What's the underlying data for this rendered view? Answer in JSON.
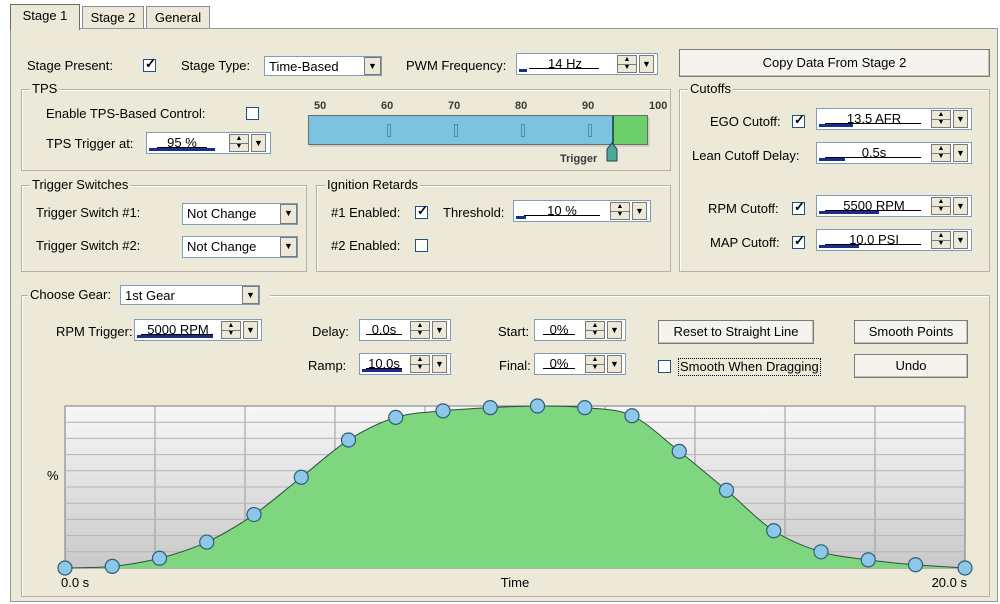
{
  "tabs": [
    "Stage 1",
    "Stage 2",
    "General"
  ],
  "top": {
    "stage_present_label": "Stage Present:",
    "stage_type_label": "Stage Type:",
    "stage_type_value": "Time-Based",
    "pwm_label": "PWM Frequency:",
    "pwm_value": "14 Hz",
    "copy_button": "Copy Data From Stage 2"
  },
  "tps": {
    "title": "TPS",
    "enable_label": "Enable TPS-Based Control:",
    "trigger_label": "TPS Trigger at:",
    "trigger_value": "95 %",
    "scale_ticks": [
      "50",
      "60",
      "70",
      "80",
      "90",
      "100"
    ],
    "trigger_marker": "Trigger",
    "trigger_fraction": 0.9
  },
  "cutoffs": {
    "title": "Cutoffs",
    "ego_label": "EGO Cutoff:",
    "ego_value": "13.5 AFR",
    "lean_label": "Lean Cutoff Delay:",
    "lean_value": "0.5s",
    "rpm_label": "RPM Cutoff:",
    "rpm_value": "5500 RPM",
    "map_label": "MAP Cutoff:",
    "map_value": "10.0 PSI"
  },
  "trigger_switches": {
    "title": "Trigger Switches",
    "sw1_label": "Trigger Switch #1:",
    "sw1_value": "Not Change",
    "sw2_label": "Trigger Switch #2:",
    "sw2_value": "Not Change"
  },
  "ignition": {
    "title": "Ignition Retards",
    "en1_label": "#1 Enabled:",
    "threshold_label": "Threshold:",
    "threshold_value": "10 %",
    "en2_label": "#2 Enabled:"
  },
  "gear": {
    "label": "Choose Gear:",
    "value": "1st Gear",
    "rpm_trigger_label": "RPM Trigger:",
    "rpm_trigger_value": "5000 RPM",
    "delay_label": "Delay:",
    "delay_value": "0.0s",
    "ramp_label": "Ramp:",
    "ramp_value": "10.0s",
    "start_label": "Start:",
    "start_value": "0%",
    "final_label": "Final:",
    "final_value": "0%",
    "reset_button": "Reset to Straight Line",
    "smooth_button": "Smooth Points",
    "smooth_drag_label": "Smooth When Dragging",
    "undo_button": "Undo"
  },
  "chart_data": {
    "type": "area",
    "xlabel": "Time",
    "ylabel": "%",
    "x_start_label": "0.0 s",
    "x_end_label": "20.0 s",
    "xlim": [
      0,
      20
    ],
    "ylim": [
      0,
      100
    ],
    "x": [
      0,
      1.05,
      2.1,
      3.15,
      4.2,
      5.25,
      6.3,
      7.35,
      8.4,
      9.45,
      10.5,
      11.55,
      12.6,
      13.65,
      14.7,
      15.75,
      16.8,
      17.85,
      18.9,
      20
    ],
    "values": [
      0,
      1,
      6,
      16,
      33,
      56,
      79,
      93,
      97,
      99,
      100,
      99,
      94,
      72,
      48,
      23,
      10,
      5,
      2,
      0
    ],
    "fill_color": "#7ed67e",
    "point_color": "#8ec8e8"
  },
  "colors": {
    "panel_bg": "#ece9d8",
    "tps_bar": "#7cc3e0",
    "tps_trigger_zone": "#6ccf6c",
    "accent": "#1a2d8c"
  }
}
